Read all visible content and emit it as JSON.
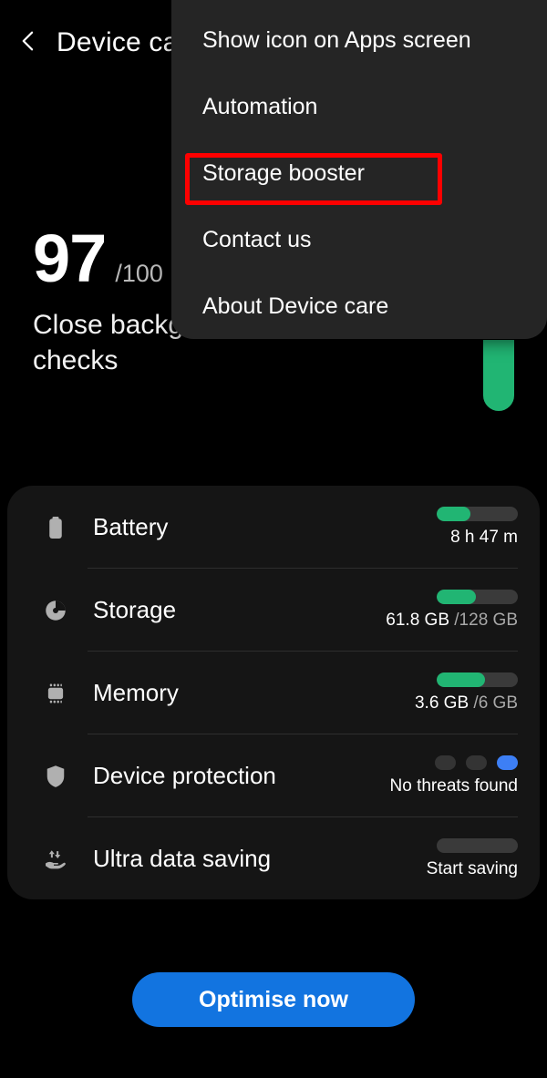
{
  "header": {
    "back_icon": "chevron-left-icon",
    "title": "Device care"
  },
  "score": {
    "value": "97",
    "denominator": "/100",
    "description": "Close background apps and run checks",
    "arc_color": "#21b573"
  },
  "card": {
    "rows": [
      {
        "icon": "battery-icon",
        "label": "Battery",
        "value_primary": "8 h 47 m",
        "value_secondary": "",
        "indicator": "bar",
        "fill_percent": 42
      },
      {
        "icon": "storage-pie-icon",
        "label": "Storage",
        "value_primary": "61.8 GB",
        "value_secondary": " /128 GB",
        "indicator": "bar",
        "fill_percent": 48
      },
      {
        "icon": "memory-chip-icon",
        "label": "Memory",
        "value_primary": "3.6 GB",
        "value_secondary": " /6 GB",
        "indicator": "bar",
        "fill_percent": 60
      },
      {
        "icon": "shield-icon",
        "label": "Device protection",
        "value_primary": "No threats found",
        "value_secondary": "",
        "indicator": "dots",
        "dots": [
          false,
          false,
          true
        ],
        "dot_active_color": "#3d7ff5"
      },
      {
        "icon": "data-saving-icon",
        "label": "Ultra data saving",
        "value_primary": "Start saving",
        "value_secondary": "",
        "indicator": "bar",
        "fill_percent": 0
      }
    ]
  },
  "optimise_button": {
    "label": "Optimise now",
    "color": "#1274e0"
  },
  "menu": {
    "items": [
      {
        "label": "Show icon on Apps screen"
      },
      {
        "label": "Automation"
      },
      {
        "label": "Storage booster"
      },
      {
        "label": "Contact us"
      },
      {
        "label": "About Device care"
      }
    ]
  },
  "annotation": {
    "highlight_target": "Storage booster",
    "color": "#fe0000"
  }
}
